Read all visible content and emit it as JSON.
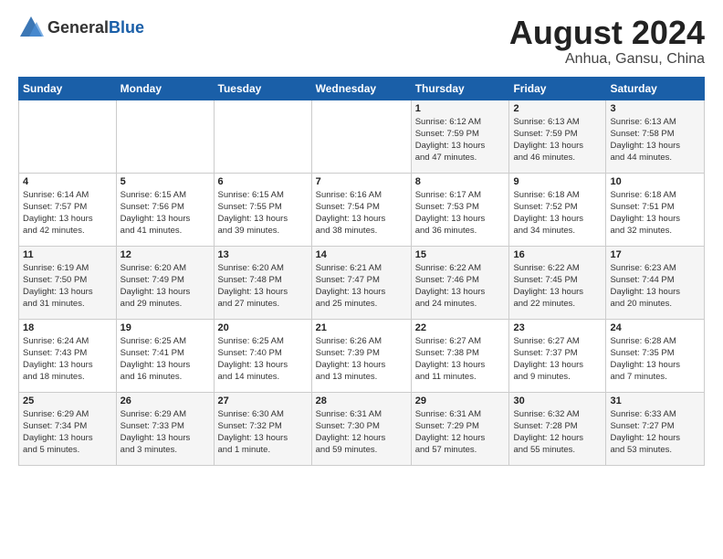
{
  "header": {
    "logo_general": "General",
    "logo_blue": "Blue",
    "title": "August 2024",
    "subtitle": "Anhua, Gansu, China"
  },
  "weekdays": [
    "Sunday",
    "Monday",
    "Tuesday",
    "Wednesday",
    "Thursday",
    "Friday",
    "Saturday"
  ],
  "rows": [
    [
      {
        "num": "",
        "info": ""
      },
      {
        "num": "",
        "info": ""
      },
      {
        "num": "",
        "info": ""
      },
      {
        "num": "",
        "info": ""
      },
      {
        "num": "1",
        "info": "Sunrise: 6:12 AM\nSunset: 7:59 PM\nDaylight: 13 hours\nand 47 minutes."
      },
      {
        "num": "2",
        "info": "Sunrise: 6:13 AM\nSunset: 7:59 PM\nDaylight: 13 hours\nand 46 minutes."
      },
      {
        "num": "3",
        "info": "Sunrise: 6:13 AM\nSunset: 7:58 PM\nDaylight: 13 hours\nand 44 minutes."
      }
    ],
    [
      {
        "num": "4",
        "info": "Sunrise: 6:14 AM\nSunset: 7:57 PM\nDaylight: 13 hours\nand 42 minutes."
      },
      {
        "num": "5",
        "info": "Sunrise: 6:15 AM\nSunset: 7:56 PM\nDaylight: 13 hours\nand 41 minutes."
      },
      {
        "num": "6",
        "info": "Sunrise: 6:15 AM\nSunset: 7:55 PM\nDaylight: 13 hours\nand 39 minutes."
      },
      {
        "num": "7",
        "info": "Sunrise: 6:16 AM\nSunset: 7:54 PM\nDaylight: 13 hours\nand 38 minutes."
      },
      {
        "num": "8",
        "info": "Sunrise: 6:17 AM\nSunset: 7:53 PM\nDaylight: 13 hours\nand 36 minutes."
      },
      {
        "num": "9",
        "info": "Sunrise: 6:18 AM\nSunset: 7:52 PM\nDaylight: 13 hours\nand 34 minutes."
      },
      {
        "num": "10",
        "info": "Sunrise: 6:18 AM\nSunset: 7:51 PM\nDaylight: 13 hours\nand 32 minutes."
      }
    ],
    [
      {
        "num": "11",
        "info": "Sunrise: 6:19 AM\nSunset: 7:50 PM\nDaylight: 13 hours\nand 31 minutes."
      },
      {
        "num": "12",
        "info": "Sunrise: 6:20 AM\nSunset: 7:49 PM\nDaylight: 13 hours\nand 29 minutes."
      },
      {
        "num": "13",
        "info": "Sunrise: 6:20 AM\nSunset: 7:48 PM\nDaylight: 13 hours\nand 27 minutes."
      },
      {
        "num": "14",
        "info": "Sunrise: 6:21 AM\nSunset: 7:47 PM\nDaylight: 13 hours\nand 25 minutes."
      },
      {
        "num": "15",
        "info": "Sunrise: 6:22 AM\nSunset: 7:46 PM\nDaylight: 13 hours\nand 24 minutes."
      },
      {
        "num": "16",
        "info": "Sunrise: 6:22 AM\nSunset: 7:45 PM\nDaylight: 13 hours\nand 22 minutes."
      },
      {
        "num": "17",
        "info": "Sunrise: 6:23 AM\nSunset: 7:44 PM\nDaylight: 13 hours\nand 20 minutes."
      }
    ],
    [
      {
        "num": "18",
        "info": "Sunrise: 6:24 AM\nSunset: 7:43 PM\nDaylight: 13 hours\nand 18 minutes."
      },
      {
        "num": "19",
        "info": "Sunrise: 6:25 AM\nSunset: 7:41 PM\nDaylight: 13 hours\nand 16 minutes."
      },
      {
        "num": "20",
        "info": "Sunrise: 6:25 AM\nSunset: 7:40 PM\nDaylight: 13 hours\nand 14 minutes."
      },
      {
        "num": "21",
        "info": "Sunrise: 6:26 AM\nSunset: 7:39 PM\nDaylight: 13 hours\nand 13 minutes."
      },
      {
        "num": "22",
        "info": "Sunrise: 6:27 AM\nSunset: 7:38 PM\nDaylight: 13 hours\nand 11 minutes."
      },
      {
        "num": "23",
        "info": "Sunrise: 6:27 AM\nSunset: 7:37 PM\nDaylight: 13 hours\nand 9 minutes."
      },
      {
        "num": "24",
        "info": "Sunrise: 6:28 AM\nSunset: 7:35 PM\nDaylight: 13 hours\nand 7 minutes."
      }
    ],
    [
      {
        "num": "25",
        "info": "Sunrise: 6:29 AM\nSunset: 7:34 PM\nDaylight: 13 hours\nand 5 minutes."
      },
      {
        "num": "26",
        "info": "Sunrise: 6:29 AM\nSunset: 7:33 PM\nDaylight: 13 hours\nand 3 minutes."
      },
      {
        "num": "27",
        "info": "Sunrise: 6:30 AM\nSunset: 7:32 PM\nDaylight: 13 hours\nand 1 minute."
      },
      {
        "num": "28",
        "info": "Sunrise: 6:31 AM\nSunset: 7:30 PM\nDaylight: 12 hours\nand 59 minutes."
      },
      {
        "num": "29",
        "info": "Sunrise: 6:31 AM\nSunset: 7:29 PM\nDaylight: 12 hours\nand 57 minutes."
      },
      {
        "num": "30",
        "info": "Sunrise: 6:32 AM\nSunset: 7:28 PM\nDaylight: 12 hours\nand 55 minutes."
      },
      {
        "num": "31",
        "info": "Sunrise: 6:33 AM\nSunset: 7:27 PM\nDaylight: 12 hours\nand 53 minutes."
      }
    ]
  ]
}
